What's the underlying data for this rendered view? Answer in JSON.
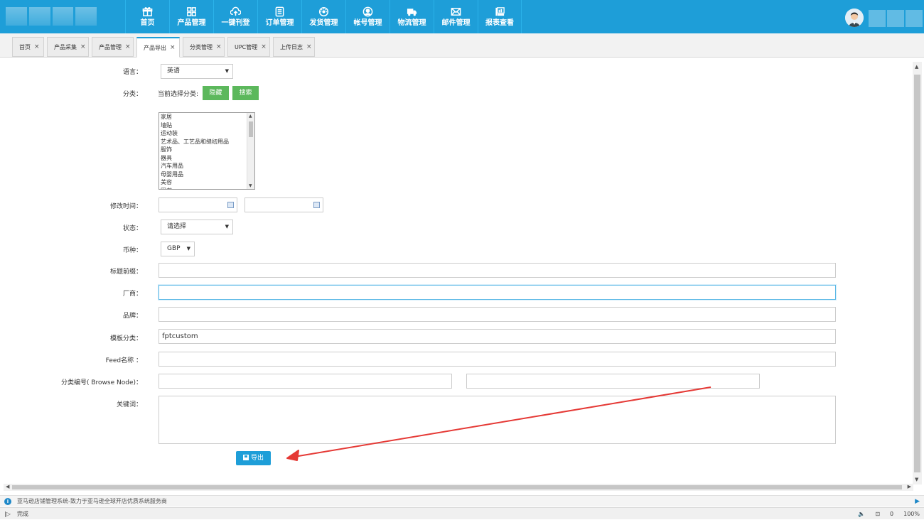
{
  "nav": {
    "items": [
      {
        "label": "首页",
        "icon": "gift-icon"
      },
      {
        "label": "产品管理",
        "icon": "grid-icon"
      },
      {
        "label": "一键刊登",
        "icon": "cloud-upload-icon"
      },
      {
        "label": "订单管理",
        "icon": "list-icon"
      },
      {
        "label": "发货管理",
        "icon": "dashboard-icon"
      },
      {
        "label": "帐号管理",
        "icon": "user-icon"
      },
      {
        "label": "物流管理",
        "icon": "truck-icon"
      },
      {
        "label": "邮件管理",
        "icon": "mail-icon"
      },
      {
        "label": "报表查看",
        "icon": "report-icon"
      }
    ]
  },
  "tabs": [
    {
      "label": "首页",
      "close": "×"
    },
    {
      "label": "产品采集",
      "close": "×"
    },
    {
      "label": "产品管理",
      "close": "×"
    },
    {
      "label": "产品导出",
      "close": "×",
      "active": true
    },
    {
      "label": "分类管理",
      "close": "×"
    },
    {
      "label": "UPC管理",
      "close": "×"
    },
    {
      "label": "上传日志",
      "close": "×"
    }
  ],
  "form": {
    "language_label": "语言：",
    "language_value": "英语",
    "category_label": "分类：",
    "category_current": "当前选择分类:",
    "hide_button": "隐藏",
    "search_button": "搜索",
    "category_options": [
      "家居",
      "墙贴",
      "运动装",
      "艺术品、工艺品和缝纫用品",
      "服饰",
      "器具",
      "汽车用品",
      "母婴用品",
      "美容",
      "图书"
    ],
    "modify_time_label": "修改时间：",
    "status_label": "状态：",
    "status_value": "请选择",
    "currency_label": "币种：",
    "currency_value": "GBP",
    "title_prefix_label": "标题前缀：",
    "manufacturer_label": "厂商：",
    "brand_label": "品牌：",
    "template_label": "模板分类：",
    "template_value": "fptcustom",
    "feed_label": "Feed名称 ：",
    "browse_node_label": "分类编号( Browse Node)：",
    "keywords_label": "关键词：",
    "export_button": "导出"
  },
  "infobar": {
    "text": "亚马逊店铺管理系统-致力于亚马逊全球开店优质系统服务商"
  },
  "statusbar": {
    "left": "完成",
    "mute": "🔈",
    "lock": "⊡",
    "shield": "0",
    "zoom": "100%"
  },
  "colors": {
    "accent": "#1e9ed8",
    "green": "#5cb85c",
    "arrow": "#e53935"
  }
}
